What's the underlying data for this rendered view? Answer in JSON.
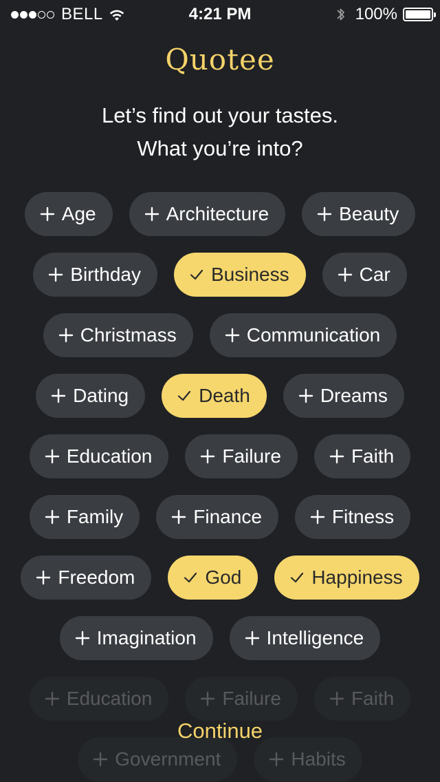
{
  "status_bar": {
    "carrier": "BELL",
    "time": "4:21 PM",
    "battery_percent": "100%",
    "signal_bars_filled": 3,
    "signal_bars_total": 5,
    "icons": [
      "wifi-icon",
      "bluetooth-icon",
      "battery-icon"
    ]
  },
  "app": {
    "title": "Quotee",
    "subtitle_line1": "Let’s find out your tastes.",
    "subtitle_line2": "What you’re into?"
  },
  "colors": {
    "background": "#1f2124",
    "tag_background": "#3a3d42",
    "accent": "#f5d36a",
    "selected_tag": "#f6d76e"
  },
  "tags": [
    [
      {
        "label": "Age",
        "selected": false
      },
      {
        "label": "Architecture",
        "selected": false
      },
      {
        "label": "Beauty",
        "selected": false
      }
    ],
    [
      {
        "label": "Birthday",
        "selected": false
      },
      {
        "label": "Business",
        "selected": true
      },
      {
        "label": "Car",
        "selected": false
      }
    ],
    [
      {
        "label": "Christmass",
        "selected": false
      },
      {
        "label": "Communication",
        "selected": false
      }
    ],
    [
      {
        "label": "Dating",
        "selected": false
      },
      {
        "label": "Death",
        "selected": true
      },
      {
        "label": "Dreams",
        "selected": false
      }
    ],
    [
      {
        "label": "Education",
        "selected": false
      },
      {
        "label": "Failure",
        "selected": false
      },
      {
        "label": "Faith",
        "selected": false
      }
    ],
    [
      {
        "label": "Family",
        "selected": false
      },
      {
        "label": "Finance",
        "selected": false
      },
      {
        "label": "Fitness",
        "selected": false
      }
    ],
    [
      {
        "label": "Freedom",
        "selected": false
      },
      {
        "label": "God",
        "selected": true
      },
      {
        "label": "Happiness",
        "selected": true
      }
    ],
    [
      {
        "label": "Imagination",
        "selected": false
      },
      {
        "label": "Intelligence",
        "selected": false
      }
    ]
  ],
  "faded_tags": [
    [
      {
        "label": "Education",
        "selected": false
      },
      {
        "label": "Failure",
        "selected": false
      },
      {
        "label": "Faith",
        "selected": false
      }
    ],
    [
      {
        "label": "Government",
        "selected": false
      },
      {
        "label": "Habits",
        "selected": false
      }
    ]
  ],
  "continue_label": "Continue"
}
